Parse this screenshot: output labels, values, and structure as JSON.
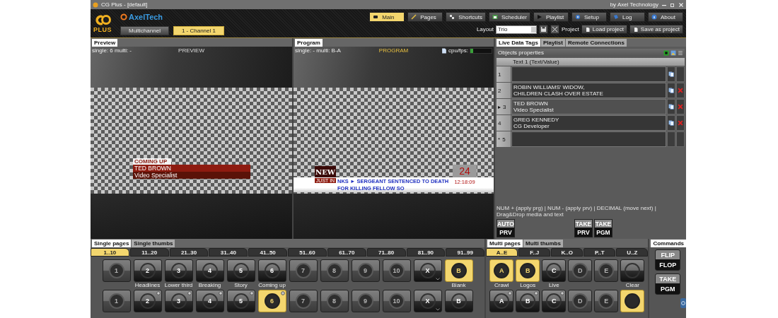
{
  "window": {
    "title": "CG Plus - [default]",
    "vendor": "by Axel Technology"
  },
  "header": {
    "logo_text": "PLUS",
    "brand": "AxelTech",
    "channels": [
      {
        "label": "Multichannel",
        "selected": false
      },
      {
        "label": "1 - Channel 1",
        "selected": true
      }
    ],
    "nav": [
      {
        "label": "Main",
        "selected": true
      },
      {
        "label": "Pages",
        "selected": false
      },
      {
        "label": "Shortcuts",
        "selected": false
      },
      {
        "label": "Scheduler",
        "selected": false
      },
      {
        "label": "Playlist",
        "selected": false
      },
      {
        "label": "Setup",
        "selected": false
      },
      {
        "label": "Log",
        "selected": false
      },
      {
        "label": "About",
        "selected": false
      }
    ],
    "layout": {
      "label": "Layout",
      "value": "Trio"
    },
    "project_label": "Project",
    "actions": [
      "Load project",
      "Save as project"
    ]
  },
  "preview": {
    "tab": "Preview",
    "info": "single: 6 multi: -",
    "label": "PREVIEW",
    "graphic": {
      "kicker": "COMING UP",
      "name": "TED BROWN",
      "role": "Video Specialist"
    }
  },
  "program": {
    "tab": "Program",
    "info": "single: - multi: B-A",
    "label": "PROGRAM",
    "cpu_label": "cpu/fps:",
    "cpu_meter": {
      "level": 0.12
    },
    "graphic": {
      "logo": "NEW",
      "badge": "JUST IN",
      "ticker_prefix": "NKS",
      "arrow": "►",
      "ticker": "SERGEANT SENTENCED TO DEATH FOR KILLING FELLOW SO",
      "channel": "24",
      "clock": "12:18:09"
    }
  },
  "data_tags": {
    "tabs": [
      {
        "label": "Live Data Tags",
        "selected": true
      },
      {
        "label": "Playlist",
        "selected": false
      },
      {
        "label": "Remote Connections",
        "selected": false
      }
    ],
    "title": "Objects properties",
    "column": "Text 1 (Text/Value)",
    "rows": [
      {
        "index": "1",
        "selected": false,
        "copy": true,
        "delete": false
      },
      {
        "index": "2",
        "lines": [
          "ROBIN WILLIAMS' WIDOW,",
          "CHILDREN CLASH OVER ESTATE"
        ],
        "selected": false,
        "copy": true,
        "delete": true
      },
      {
        "index": "3",
        "marker": "▸",
        "lines": [
          "TED BROWN",
          "Video Specialist"
        ],
        "selected": true,
        "copy": true,
        "delete": true
      },
      {
        "index": "4",
        "lines": [
          "GREG KENNEDY",
          "CG Developer"
        ],
        "selected": false,
        "copy": true,
        "delete": true
      },
      {
        "index": "5",
        "marker": "*",
        "selected": false,
        "copy": false,
        "delete": false
      }
    ],
    "hint": "NUM + (apply prg) | NUM - (apply prv) | DECIMAL (move next) | Drag&Drop media and text",
    "buttons": [
      {
        "top": "AUTO",
        "bottom": "PRV"
      },
      {
        "top": "TAKE",
        "bottom": "PRV"
      },
      {
        "top": "TAKE",
        "bottom": "PGM"
      }
    ]
  },
  "single_pages": {
    "tabs": [
      {
        "label": "Single pages",
        "selected": true
      },
      {
        "label": "Single thumbs",
        "selected": false
      }
    ],
    "ranges": [
      {
        "label": "1..10",
        "selected": true
      },
      {
        "label": "11..20",
        "selected": false
      },
      {
        "label": "21..30",
        "selected": false
      },
      {
        "label": "31..40",
        "selected": false
      },
      {
        "label": "41..50",
        "selected": false
      },
      {
        "label": "51..60",
        "selected": false
      },
      {
        "label": "61..70",
        "selected": false
      },
      {
        "label": "71..80",
        "selected": false
      },
      {
        "label": "81..90",
        "selected": false
      },
      {
        "label": "91..99",
        "selected": false
      }
    ],
    "rows": [
      {
        "buttons": [
          {
            "label": "1",
            "enabled": false,
            "selected": false,
            "gear": false,
            "caret": false
          },
          {
            "label": "2",
            "caption": "Headlines",
            "enabled": true,
            "selected": false,
            "gear": false,
            "caret": false
          },
          {
            "label": "3",
            "caption": "Lower third",
            "enabled": true,
            "selected": false,
            "gear": false,
            "caret": false
          },
          {
            "label": "4",
            "caption": "Breaking",
            "enabled": true,
            "selected": false,
            "gear": false,
            "caret": false
          },
          {
            "label": "5",
            "caption": "Story",
            "enabled": true,
            "selected": false,
            "gear": false,
            "caret": false
          },
          {
            "label": "6",
            "caption": "Coming up",
            "enabled": true,
            "selected": false,
            "gear": false,
            "caret": false
          },
          {
            "label": "7",
            "enabled": false,
            "selected": false,
            "gear": false,
            "caret": false
          },
          {
            "label": "8",
            "enabled": false,
            "selected": false,
            "gear": false,
            "caret": false
          },
          {
            "label": "9",
            "enabled": false,
            "selected": false,
            "gear": false,
            "caret": false
          },
          {
            "label": "10",
            "enabled": false,
            "selected": false,
            "gear": false,
            "caret": false
          },
          {
            "label": "X",
            "enabled": true,
            "selected": false,
            "gear": false,
            "caret": true
          },
          {
            "label": "B",
            "caption": "Blank",
            "enabled": true,
            "selected": true,
            "gear": false,
            "caret": false
          }
        ]
      },
      {
        "buttons": [
          {
            "label": "1",
            "enabled": false,
            "selected": false,
            "gear": false,
            "caret": false
          },
          {
            "label": "2",
            "enabled": true,
            "selected": false,
            "gear": true,
            "caret": false
          },
          {
            "label": "3",
            "enabled": true,
            "selected": false,
            "gear": true,
            "caret": false
          },
          {
            "label": "4",
            "enabled": true,
            "selected": false,
            "gear": true,
            "caret": false
          },
          {
            "label": "5",
            "enabled": true,
            "selected": false,
            "gear": true,
            "caret": false
          },
          {
            "label": "6",
            "enabled": true,
            "selected": true,
            "gear": true,
            "caret": false
          },
          {
            "label": "7",
            "enabled": false,
            "selected": false,
            "gear": false,
            "caret": false
          },
          {
            "label": "8",
            "enabled": false,
            "selected": false,
            "gear": false,
            "caret": false
          },
          {
            "label": "9",
            "enabled": false,
            "selected": false,
            "gear": false,
            "caret": false
          },
          {
            "label": "10",
            "enabled": false,
            "selected": false,
            "gear": false,
            "caret": false
          },
          {
            "label": "X",
            "enabled": true,
            "selected": false,
            "gear": false,
            "caret": true
          },
          {
            "label": "B",
            "enabled": true,
            "selected": false,
            "gear": false,
            "caret": false
          }
        ]
      }
    ]
  },
  "multi_pages": {
    "tabs": [
      {
        "label": "Multi pages",
        "selected": true
      },
      {
        "label": "Multi thumbs",
        "selected": false
      }
    ],
    "ranges": [
      {
        "label": "A..E",
        "selected": true
      },
      {
        "label": "F..J",
        "selected": false
      },
      {
        "label": "K..O",
        "selected": false
      },
      {
        "label": "P..T",
        "selected": false
      },
      {
        "label": "U..Z",
        "selected": false
      }
    ],
    "rows": [
      {
        "buttons": [
          {
            "label": "A",
            "caption": "Crawl",
            "enabled": true,
            "selected": true,
            "gear": false,
            "caret": false
          },
          {
            "label": "B",
            "caption": "Logos",
            "enabled": true,
            "selected": true,
            "gear": false,
            "caret": false
          },
          {
            "label": "C",
            "caption": "Live",
            "enabled": true,
            "selected": false,
            "gear": false,
            "caret": false
          },
          {
            "label": "D",
            "enabled": false,
            "selected": false,
            "gear": false,
            "caret": false
          },
          {
            "label": "E",
            "enabled": false,
            "selected": false,
            "gear": false,
            "caret": false
          },
          {
            "caption": "Clear",
            "enabled": true,
            "selected": false,
            "gear": false,
            "caret": false
          }
        ]
      },
      {
        "buttons": [
          {
            "label": "A",
            "enabled": true,
            "selected": false,
            "gear": true,
            "caret": false
          },
          {
            "label": "B",
            "enabled": true,
            "selected": false,
            "gear": true,
            "caret": false
          },
          {
            "label": "C",
            "enabled": true,
            "selected": false,
            "gear": true,
            "caret": false
          },
          {
            "label": "D",
            "enabled": false,
            "selected": false,
            "gear": false,
            "caret": false
          },
          {
            "label": "E",
            "enabled": false,
            "selected": false,
            "gear": false,
            "caret": false
          },
          {
            "enabled": true,
            "selected": true,
            "gear": false,
            "caret": false
          }
        ]
      }
    ]
  },
  "commands": {
    "tab": "Commands",
    "buttons": [
      {
        "top": "FLIP",
        "bottom": "FLOP"
      },
      {
        "top": "TAKE",
        "bottom": "PGM"
      }
    ]
  }
}
